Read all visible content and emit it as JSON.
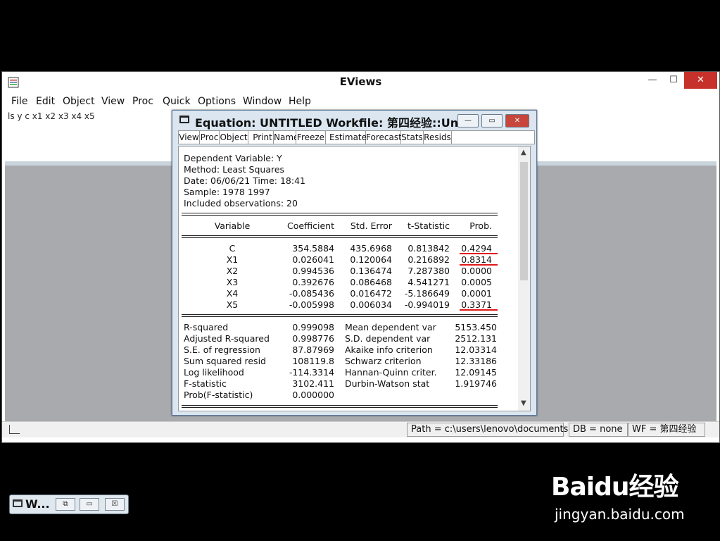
{
  "app": {
    "title": "EViews"
  },
  "window_controls": {
    "minimize": "—",
    "maximize": "☐",
    "close": "✕"
  },
  "menu": [
    "File",
    "Edit",
    "Object",
    "View",
    "Proc",
    "Quick",
    "Options",
    "Window",
    "Help"
  ],
  "command": "ls  y c x1 x2 x3 x4 x5",
  "minimized_window": {
    "label": "W...",
    "buttons": [
      "⧉",
      "▭",
      "☒"
    ]
  },
  "status": {
    "path": "Path = c:\\users\\lenovo\\documents",
    "db": "DB = none",
    "wf": "WF = 第四经验"
  },
  "equation": {
    "title": "Equation: UNTITLED   Workfile: 第四经验::Unt...",
    "controls": [
      "—",
      "▭",
      "✕"
    ],
    "toolbar": [
      "View",
      "Proc",
      "Object",
      "Print",
      "Name",
      "Freeze",
      "Estimate",
      "Forecast",
      "Stats",
      "Resids"
    ],
    "header": [
      "Dependent Variable: Y",
      "Method: Least Squares",
      "Date: 06/06/21   Time: 18:41",
      "Sample: 1978 1997",
      "Included observations: 20"
    ],
    "columns": [
      "Variable",
      "Coefficient",
      "Std. Error",
      "t-Statistic",
      "Prob."
    ],
    "rows": [
      [
        "C",
        "354.5884",
        "435.6968",
        "0.813842",
        "0.4294"
      ],
      [
        "X1",
        "0.026041",
        "0.120064",
        "0.216892",
        "0.8314"
      ],
      [
        "X2",
        "0.994536",
        "0.136474",
        "7.287380",
        "0.0000"
      ],
      [
        "X3",
        "0.392676",
        "0.086468",
        "4.541271",
        "0.0005"
      ],
      [
        "X4",
        "-0.085436",
        "0.016472",
        "-5.186649",
        "0.0001"
      ],
      [
        "X5",
        "-0.005998",
        "0.006034",
        "-0.994019",
        "0.3371"
      ]
    ],
    "stats_left": [
      [
        "R-squared",
        "0.999098"
      ],
      [
        "Adjusted R-squared",
        "0.998776"
      ],
      [
        "S.E. of regression",
        "87.87969"
      ],
      [
        "Sum squared resid",
        "108119.8"
      ],
      [
        "Log likelihood",
        "-114.3314"
      ],
      [
        "F-statistic",
        "3102.411"
      ],
      [
        "Prob(F-statistic)",
        "0.000000"
      ]
    ],
    "stats_right": [
      [
        "Mean dependent var",
        "5153.450"
      ],
      [
        "S.D. dependent var",
        "2512.131"
      ],
      [
        "Akaike info criterion",
        "12.03314"
      ],
      [
        "Schwarz criterion",
        "12.33186"
      ],
      [
        "Hannan-Quinn criter.",
        "12.09145"
      ],
      [
        "Durbin-Watson stat",
        "1.919746"
      ]
    ],
    "highlight_color": "#e01818"
  },
  "watermark": {
    "brand": "Baidu经验",
    "url": "jingyan.baidu.com"
  }
}
